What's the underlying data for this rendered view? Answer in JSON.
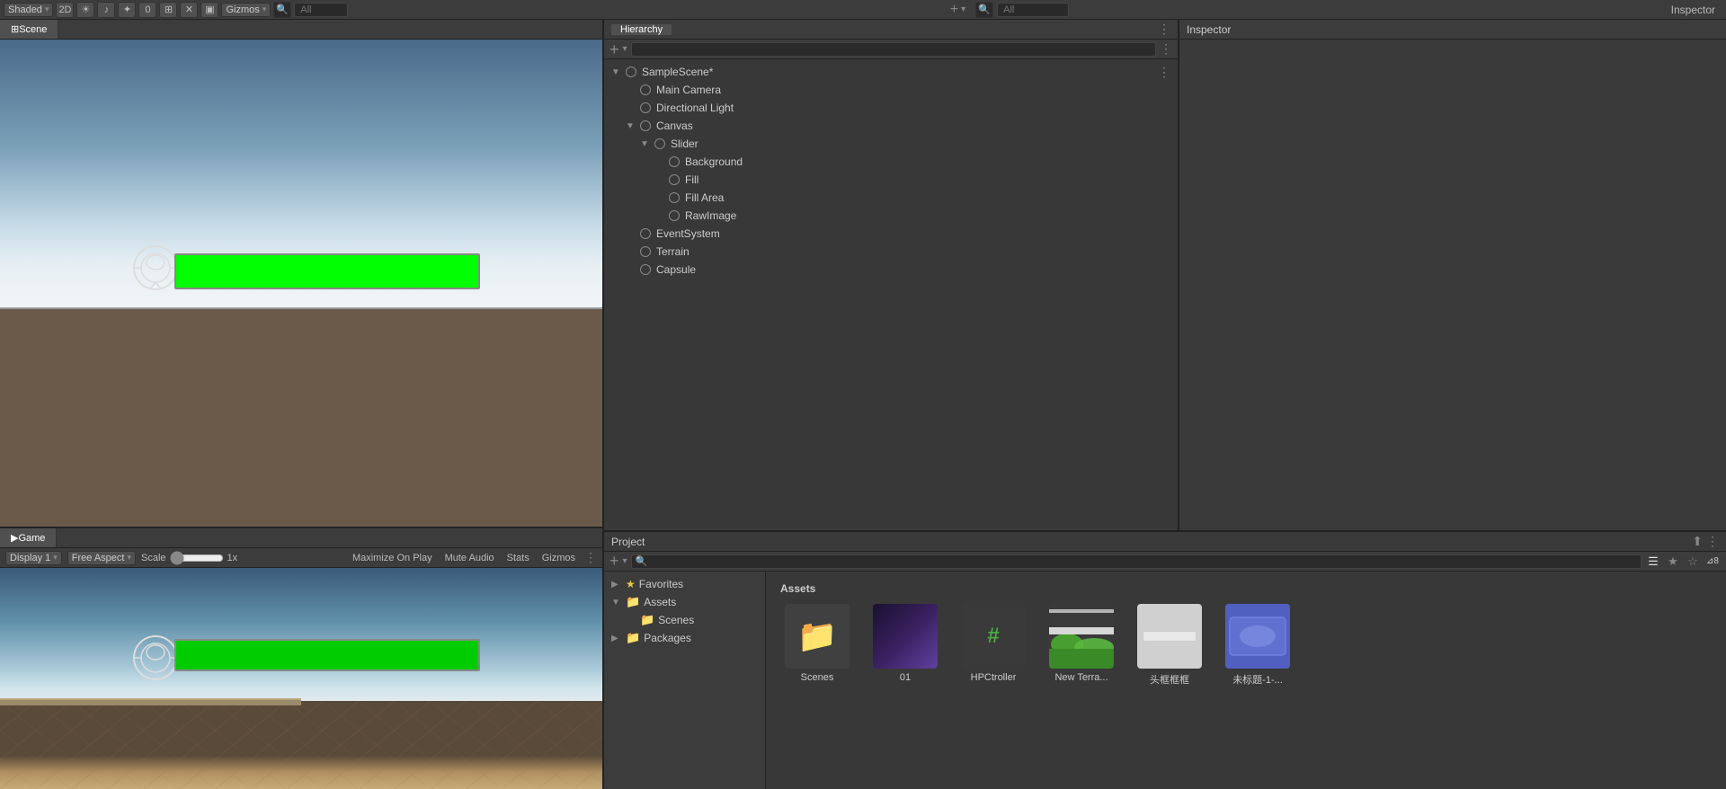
{
  "topbar": {
    "shaded_label": "Shaded",
    "btn_2d": "2D",
    "gizmos_label": "Gizmos",
    "search_placeholder": "All",
    "add_btn": "+",
    "hierarchy_search_placeholder": "All",
    "inspector_label": "Inspector"
  },
  "scene": {
    "tab_label": "Scene",
    "tab_icon": "⋮"
  },
  "game": {
    "tab_label": "Game",
    "tab_icon": "⋮",
    "display_label": "Display 1",
    "aspect_label": "Free Aspect",
    "scale_label": "Scale",
    "scale_value": "1x",
    "maximize_label": "Maximize On Play",
    "mute_label": "Mute Audio",
    "stats_label": "Stats",
    "gizmos_label": "Gizmos"
  },
  "hierarchy": {
    "title": "Hierarchy",
    "add_btn": "+",
    "items": [
      {
        "label": "SampleScene*",
        "indent": 0,
        "has_arrow": true,
        "arrow": "▼",
        "modified": true
      },
      {
        "label": "Main Camera",
        "indent": 1,
        "has_arrow": false,
        "arrow": ""
      },
      {
        "label": "Directional Light",
        "indent": 1,
        "has_arrow": false,
        "arrow": ""
      },
      {
        "label": "Canvas",
        "indent": 1,
        "has_arrow": true,
        "arrow": "▼"
      },
      {
        "label": "Slider",
        "indent": 2,
        "has_arrow": true,
        "arrow": "▼"
      },
      {
        "label": "Background",
        "indent": 3,
        "has_arrow": false,
        "arrow": ""
      },
      {
        "label": "Fill",
        "indent": 3,
        "has_arrow": false,
        "arrow": ""
      },
      {
        "label": "Fill Area",
        "indent": 3,
        "has_arrow": false,
        "arrow": ""
      },
      {
        "label": "RawImage",
        "indent": 3,
        "has_arrow": false,
        "arrow": ""
      },
      {
        "label": "EventSystem",
        "indent": 1,
        "has_arrow": false,
        "arrow": ""
      },
      {
        "label": "Terrain",
        "indent": 1,
        "has_arrow": false,
        "arrow": ""
      },
      {
        "label": "Capsule",
        "indent": 1,
        "has_arrow": false,
        "arrow": ""
      }
    ]
  },
  "inspector": {
    "title": "Inspector"
  },
  "project": {
    "title": "Project",
    "add_btn": "+",
    "search_placeholder": "",
    "sidebar": {
      "favorites_label": "Favorites",
      "assets_label": "Assets",
      "scenes_label": "Scenes",
      "packages_label": "Packages"
    },
    "assets_title": "Assets",
    "assets": [
      {
        "name": "Scenes",
        "type": "folder"
      },
      {
        "name": "01",
        "type": "scene"
      },
      {
        "name": "HPCtroller",
        "type": "script"
      },
      {
        "name": "New Terra...",
        "type": "terrain"
      },
      {
        "name": "头框框框",
        "type": "image"
      },
      {
        "name": "未标题-1-...",
        "type": "image2"
      }
    ]
  }
}
